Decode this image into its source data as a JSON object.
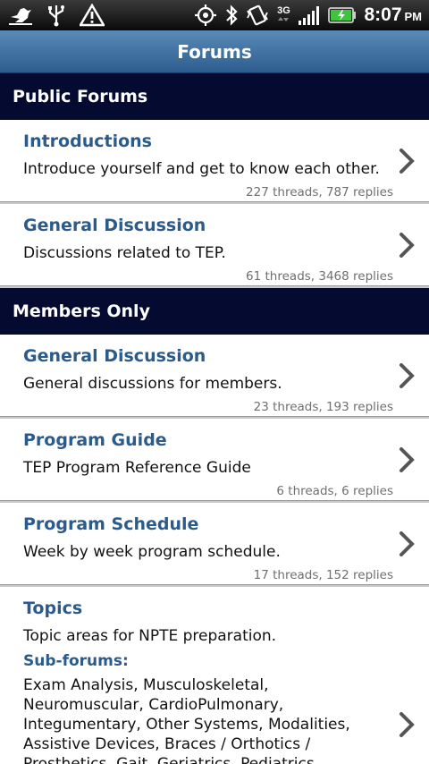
{
  "status_bar": {
    "left_icons": [
      "notification-bird-icon",
      "usb-icon",
      "warning-icon"
    ],
    "right_icons": [
      "gps-icon",
      "bluetooth-icon",
      "vibrate-icon",
      "3g-data-icon",
      "signal-icon",
      "battery-charging-icon"
    ],
    "network_label": "3G",
    "time": "8:07",
    "ampm": "PM"
  },
  "title": "Forums",
  "sections": [
    {
      "header": "Public Forums",
      "items": [
        {
          "title": "Introductions",
          "description": "Introduce yourself and get to know each other.",
          "stats": "227 threads, 787 replies"
        },
        {
          "title": "General Discussion",
          "description": "Discussions related to TEP.",
          "stats": "61 threads, 3468 replies"
        }
      ]
    },
    {
      "header": "Members Only",
      "items": [
        {
          "title": "General Discussion",
          "description": "General discussions for members.",
          "stats": "23 threads, 193 replies"
        },
        {
          "title": "Program Guide",
          "description": "TEP Program Reference Guide",
          "stats": "6 threads, 6 replies"
        },
        {
          "title": "Program Schedule",
          "description": "Week by week program schedule.",
          "stats": "17 threads, 152 replies"
        }
      ],
      "topics": {
        "title": "Topics",
        "description": "Topic areas for NPTE preparation.",
        "sub_forums_label": "Sub-forums:",
        "sub_forums": "Exam Analysis, Musculoskeletal, Neuromuscular, CardioPulmonary, Integumentary, Other Systems, Modalities, Assistive Devices, Braces / Orthotics / Prosthetics, Gait, Geriatrics, Pediatrics, Therapeutic Interventions, Professional Roles,"
      }
    }
  ]
}
